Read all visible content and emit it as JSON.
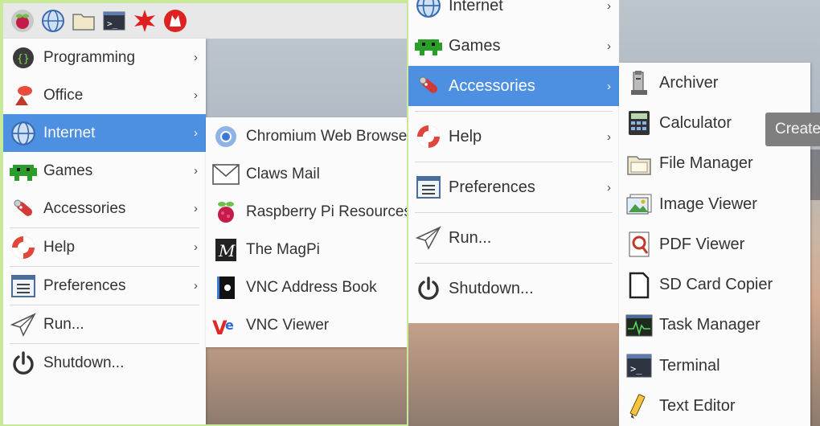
{
  "left_menu": {
    "items": [
      {
        "label": "Programming",
        "icon": "programming-icon",
        "arrow": "›"
      },
      {
        "label": "Office",
        "icon": "office-icon",
        "arrow": "›"
      },
      {
        "label": "Internet",
        "icon": "globe-icon",
        "arrow": "›",
        "selected": true
      },
      {
        "label": "Games",
        "icon": "games-icon",
        "arrow": "›"
      },
      {
        "label": "Accessories",
        "icon": "accessories-icon",
        "arrow": "›"
      },
      {
        "label": "Help",
        "icon": "help-icon",
        "arrow": "›"
      },
      {
        "label": "Preferences",
        "icon": "preferences-icon",
        "arrow": "›"
      },
      {
        "label": "Run...",
        "icon": "run-icon"
      },
      {
        "label": "Shutdown...",
        "icon": "shutdown-icon"
      }
    ]
  },
  "internet_submenu": {
    "items": [
      {
        "label": "Chromium Web Browser",
        "icon": "chromium-icon"
      },
      {
        "label": "Claws Mail",
        "icon": "mail-icon"
      },
      {
        "label": "Raspberry Pi Resources",
        "icon": "raspberry-icon"
      },
      {
        "label": "The MagPi",
        "icon": "magpi-icon"
      },
      {
        "label": "VNC Address Book",
        "icon": "vnc-book-icon"
      },
      {
        "label": "VNC Viewer",
        "icon": "vnc-viewer-icon"
      }
    ]
  },
  "right_menu": {
    "items": [
      {
        "label": "Internet",
        "icon": "globe-icon",
        "arrow": "›"
      },
      {
        "label": "Games",
        "icon": "games-icon",
        "arrow": "›"
      },
      {
        "label": "Accessories",
        "icon": "accessories-icon",
        "arrow": "›",
        "selected": true
      },
      {
        "label": "Help",
        "icon": "help-icon",
        "arrow": "›"
      },
      {
        "label": "Preferences",
        "icon": "preferences-icon",
        "arrow": "›"
      },
      {
        "label": "Run...",
        "icon": "run-icon"
      },
      {
        "label": "Shutdown...",
        "icon": "shutdown-icon"
      }
    ]
  },
  "accessories_submenu": {
    "items": [
      {
        "label": "Archiver",
        "icon": "archiver-icon"
      },
      {
        "label": "Calculator",
        "icon": "calculator-icon"
      },
      {
        "label": "File Manager",
        "icon": "folder-icon"
      },
      {
        "label": "Image Viewer",
        "icon": "image-viewer-icon"
      },
      {
        "label": "PDF Viewer",
        "icon": "pdf-icon"
      },
      {
        "label": "SD Card Copier",
        "icon": "sdcard-icon"
      },
      {
        "label": "Task Manager",
        "icon": "task-manager-icon"
      },
      {
        "label": "Terminal",
        "icon": "terminal-icon"
      },
      {
        "label": "Text Editor",
        "icon": "text-editor-icon"
      }
    ]
  },
  "tooltip": {
    "text": "Create"
  },
  "colors": {
    "selection": "#4d8fe0",
    "border": "#c8e89a"
  }
}
